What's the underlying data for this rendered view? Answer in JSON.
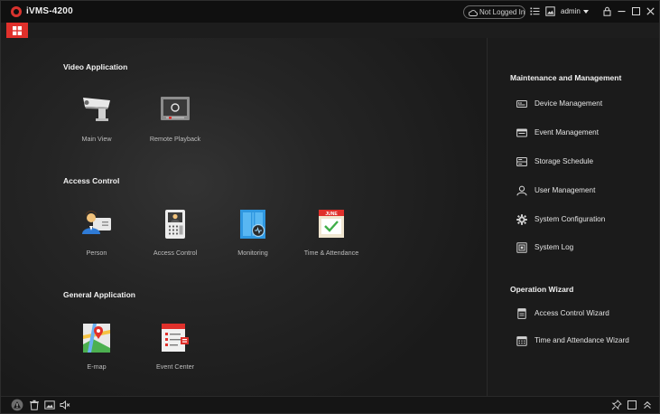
{
  "window": {
    "title": "iVMS-4200",
    "login_status": "Not Logged In",
    "user": "admin"
  },
  "sections": [
    {
      "title": "Video Application",
      "tiles": [
        {
          "label": "Main View",
          "icon": "camera-icon"
        },
        {
          "label": "Remote Playback",
          "icon": "playback-icon"
        }
      ]
    },
    {
      "title": "Access Control",
      "tiles": [
        {
          "label": "Person",
          "icon": "person-card-icon"
        },
        {
          "label": "Access Control",
          "icon": "access-terminal-icon"
        },
        {
          "label": "Monitoring",
          "icon": "monitoring-door-icon"
        },
        {
          "label": "Time & Attendance",
          "icon": "calendar-check-icon",
          "badge": "JUNE"
        }
      ]
    },
    {
      "title": "General Application",
      "tiles": [
        {
          "label": "E-map",
          "icon": "map-pin-icon"
        },
        {
          "label": "Event Center",
          "icon": "event-list-icon"
        }
      ]
    }
  ],
  "maintenance": {
    "title": "Maintenance and Management",
    "items": [
      {
        "label": "Device Management",
        "icon": "device-icon"
      },
      {
        "label": "Event Management",
        "icon": "event-icon"
      },
      {
        "label": "Storage Schedule",
        "icon": "storage-icon"
      },
      {
        "label": "User Management",
        "icon": "user-icon"
      },
      {
        "label": "System Configuration",
        "icon": "gear-icon"
      },
      {
        "label": "System Log",
        "icon": "log-icon"
      }
    ]
  },
  "wizard": {
    "title": "Operation Wizard",
    "items": [
      {
        "label": "Access Control Wizard",
        "icon": "wizard-doc-icon"
      },
      {
        "label": "Time and Attendance Wizard",
        "icon": "wizard-calendar-icon"
      }
    ]
  },
  "colors": {
    "accent": "#e0302b",
    "background": "#1d1d1d",
    "panel": "#1b1b1b"
  }
}
